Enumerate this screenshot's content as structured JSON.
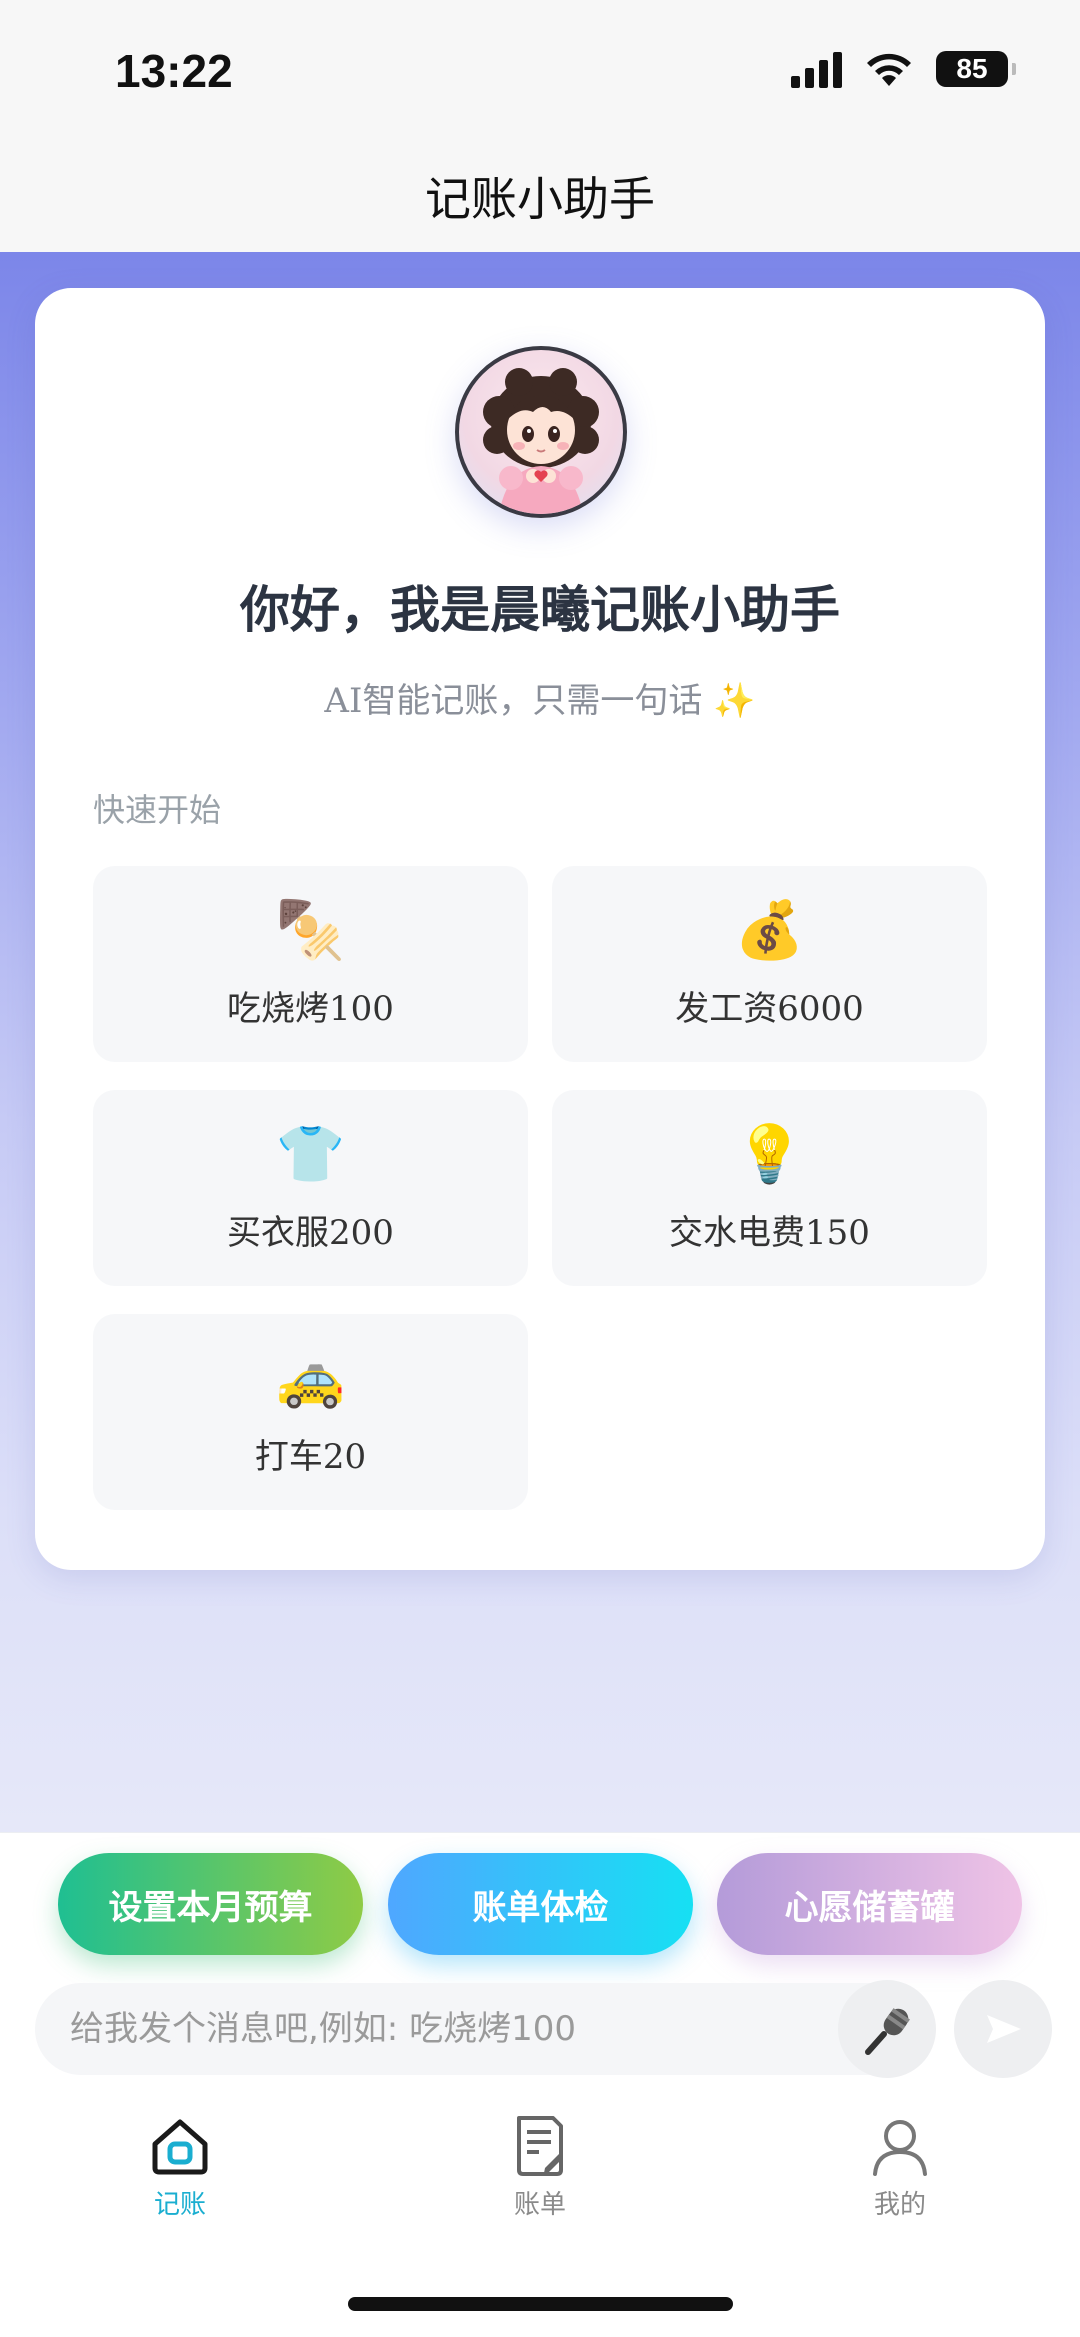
{
  "status_bar": {
    "time": "13:22",
    "battery": "85"
  },
  "header": {
    "title": "记账小助手"
  },
  "welcome": {
    "greeting": "你好，我是晨曦记账小助手",
    "subtitle": "AI智能记账，只需一句话 ✨",
    "section_label": "快速开始"
  },
  "quick_actions": [
    {
      "emoji": "🍢",
      "label": "吃烧烤100",
      "icon": "skewer-icon"
    },
    {
      "emoji": "💰",
      "label": "发工资6000",
      "icon": "money-bag-icon"
    },
    {
      "emoji": "👕",
      "label": "买衣服200",
      "icon": "shirt-icon"
    },
    {
      "emoji": "💡",
      "label": "交水电费150",
      "icon": "lightbulb-icon"
    },
    {
      "emoji": "🚕",
      "label": "打车20",
      "icon": "taxi-icon"
    }
  ],
  "action_pills": {
    "budget": "设置本月预算",
    "check": "账单体检",
    "wish": "心愿储蓄罐"
  },
  "composer": {
    "placeholder": "给我发个消息吧,例如: 吃烧烤100"
  },
  "tabs": [
    {
      "label": "记账",
      "active": true
    },
    {
      "label": "账单",
      "active": false
    },
    {
      "label": "我的",
      "active": false
    }
  ],
  "colors": {
    "accent": "#1aaed0",
    "hero_top": "#7c86e9",
    "hero_bottom": "#e6e8f9"
  }
}
